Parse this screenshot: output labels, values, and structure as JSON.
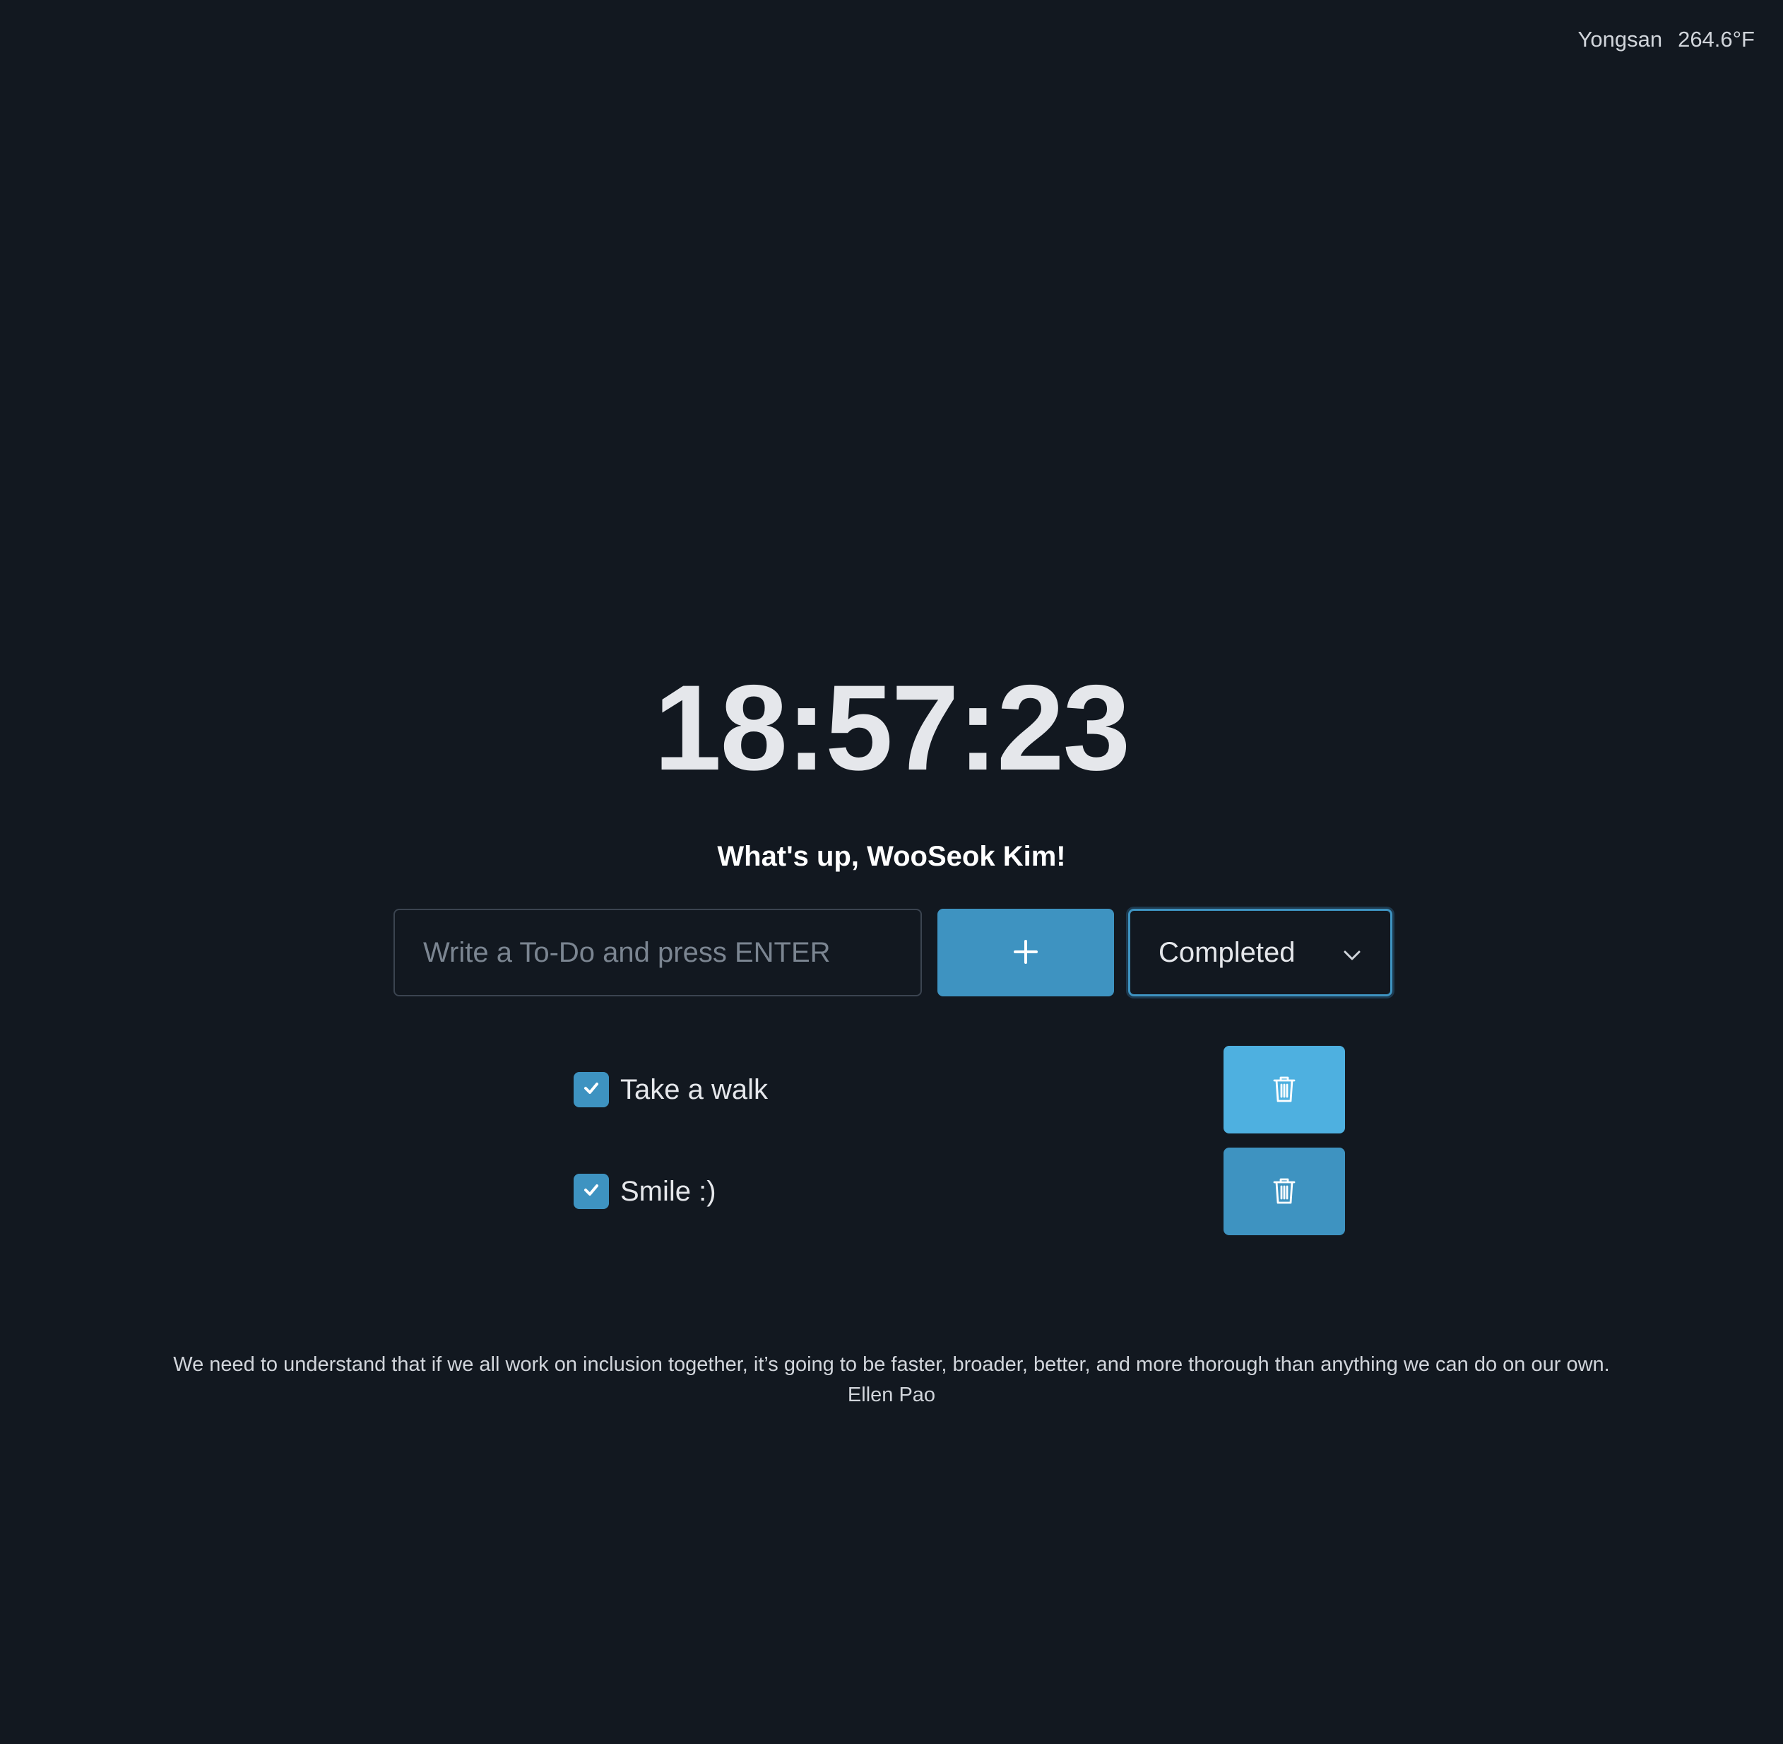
{
  "weather": {
    "city": "Yongsan",
    "temperature": "264.6°F"
  },
  "clock": {
    "time": "18:57:23"
  },
  "greeting": "What's up, WooSeok Kim!",
  "todo_form": {
    "input_value": "",
    "input_placeholder": "Write a To-Do and press ENTER",
    "add_button_icon": "plus-icon",
    "filter_selected": "Completed"
  },
  "todos": [
    {
      "label": "Take a walk",
      "checked": true,
      "delete_icon": "trash-icon"
    },
    {
      "label": "Smile :)",
      "checked": true,
      "delete_icon": "trash-icon"
    }
  ],
  "quote": {
    "text": "We need to understand that if we all work on inclusion together, it’s going to be faster, broader, better, and more thorough than anything we can do on our own.",
    "author": "Ellen Pao"
  },
  "colors": {
    "background": "#121820",
    "accent": "#3e93c1",
    "accent_hover": "#4eb0e0"
  }
}
